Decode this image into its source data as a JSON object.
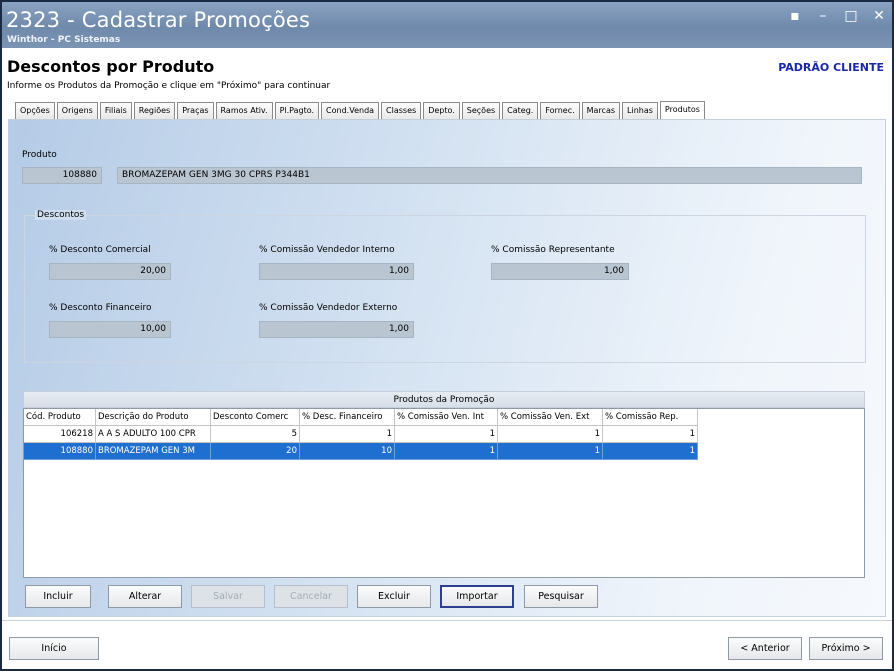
{
  "window": {
    "title": "2323 - Cadastrar Promoções",
    "subtitle": "Winthor - PC Sistemas",
    "buttons": [
      "▪",
      "–",
      "□",
      "✕"
    ]
  },
  "header": {
    "title": "Descontos por Produto",
    "instruction": "Informe os Produtos da Promoção e clique em \"Próximo\" para continuar",
    "badge": "PADRÃO CLIENTE"
  },
  "tabs": [
    {
      "label": "Opções"
    },
    {
      "label": "Origens"
    },
    {
      "label": "Filiais"
    },
    {
      "label": "Regiões"
    },
    {
      "label": "Praças"
    },
    {
      "label": "Ramos Ativ."
    },
    {
      "label": "Pl.Pagto."
    },
    {
      "label": "Cond.Venda"
    },
    {
      "label": "Classes"
    },
    {
      "label": "Depto."
    },
    {
      "label": "Seções"
    },
    {
      "label": "Categ."
    },
    {
      "label": "Fornec."
    },
    {
      "label": "Marcas"
    },
    {
      "label": "Linhas"
    },
    {
      "label": "Produtos"
    }
  ],
  "produto": {
    "label": "Produto",
    "codigo": "108880",
    "descricao": "BROMAZEPAM GEN 3MG 30 CPRS P344B1"
  },
  "descontos": {
    "group_label": "Descontos",
    "desc_comercial_label": "% Desconto Comercial",
    "desc_comercial": "20,00",
    "desc_financeiro_label": "% Desconto Financeiro",
    "desc_financeiro": "10,00",
    "com_interno_label": "% Comissão Vendedor Interno",
    "com_interno": "1,00",
    "com_externo_label": "% Comissão Vendedor Externo",
    "com_externo": "1,00",
    "com_rep_label": "% Comissão Representante",
    "com_rep": "1,00"
  },
  "grid": {
    "title": "Produtos da Promoção",
    "columns": [
      "Cód. Produto",
      "Descrição do Produto",
      "Desconto Comerc",
      "% Desc. Financeiro",
      "% Comissão Ven. Int",
      "% Comissão Ven. Ext",
      "% Comissão Rep."
    ],
    "rows": [
      [
        "106218",
        "A A S ADULTO 100 CPR",
        "5",
        "1",
        "1",
        "1",
        "1"
      ],
      [
        "108880",
        "BROMAZEPAM GEN 3M",
        "20",
        "10",
        "1",
        "1",
        "1"
      ]
    ],
    "selected_row": 1
  },
  "actions": {
    "incluir": "Incluir",
    "alterar": "Alterar",
    "salvar": "Salvar",
    "cancelar": "Cancelar",
    "excluir": "Excluir",
    "importar": "Importar",
    "pesquisar": "Pesquisar"
  },
  "footer": {
    "inicio": "Início",
    "anterior": "< Anterior",
    "proximo": "Próximo >"
  }
}
